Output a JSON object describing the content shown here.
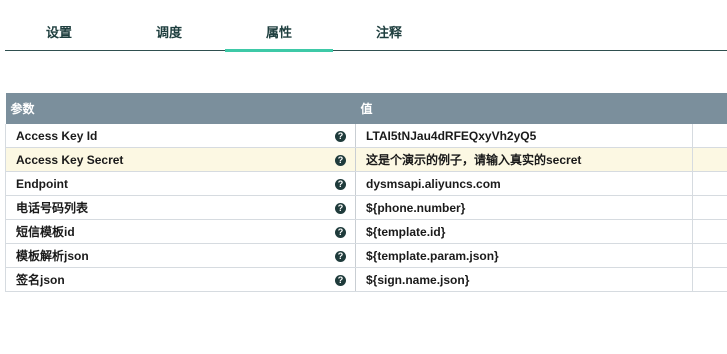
{
  "tabs": [
    {
      "label": "设置",
      "active": false
    },
    {
      "label": "调度",
      "active": false
    },
    {
      "label": "属性",
      "active": true
    },
    {
      "label": "注释",
      "active": false
    }
  ],
  "table": {
    "headers": {
      "param": "参数",
      "value": "值"
    },
    "help_icon": "question-circle-icon",
    "help_glyph": "?",
    "rows": [
      {
        "key": "Access Key Id",
        "value": "LTAI5tNJau4dRFEQxyVh2yQ5",
        "highlight": false
      },
      {
        "key": "Access Key Secret",
        "value": "这是个演示的例子，请输入真实的secret",
        "highlight": true
      },
      {
        "key": "Endpoint",
        "value": "dysmsapi.aliyuncs.com",
        "highlight": false
      },
      {
        "key": "电话号码列表",
        "value": "${phone.number}",
        "highlight": false
      },
      {
        "key": "短信模板id",
        "value": "${template.id}",
        "highlight": false
      },
      {
        "key": "模板解析json",
        "value": "${template.param.json}",
        "highlight": false
      },
      {
        "key": "签名json",
        "value": "${sign.name.json}",
        "highlight": false
      }
    ]
  },
  "colors": {
    "header_bg": "#7b8f9c",
    "active_tab_underline": "#3ec9a7",
    "highlight_row": "#fcf8e3"
  }
}
